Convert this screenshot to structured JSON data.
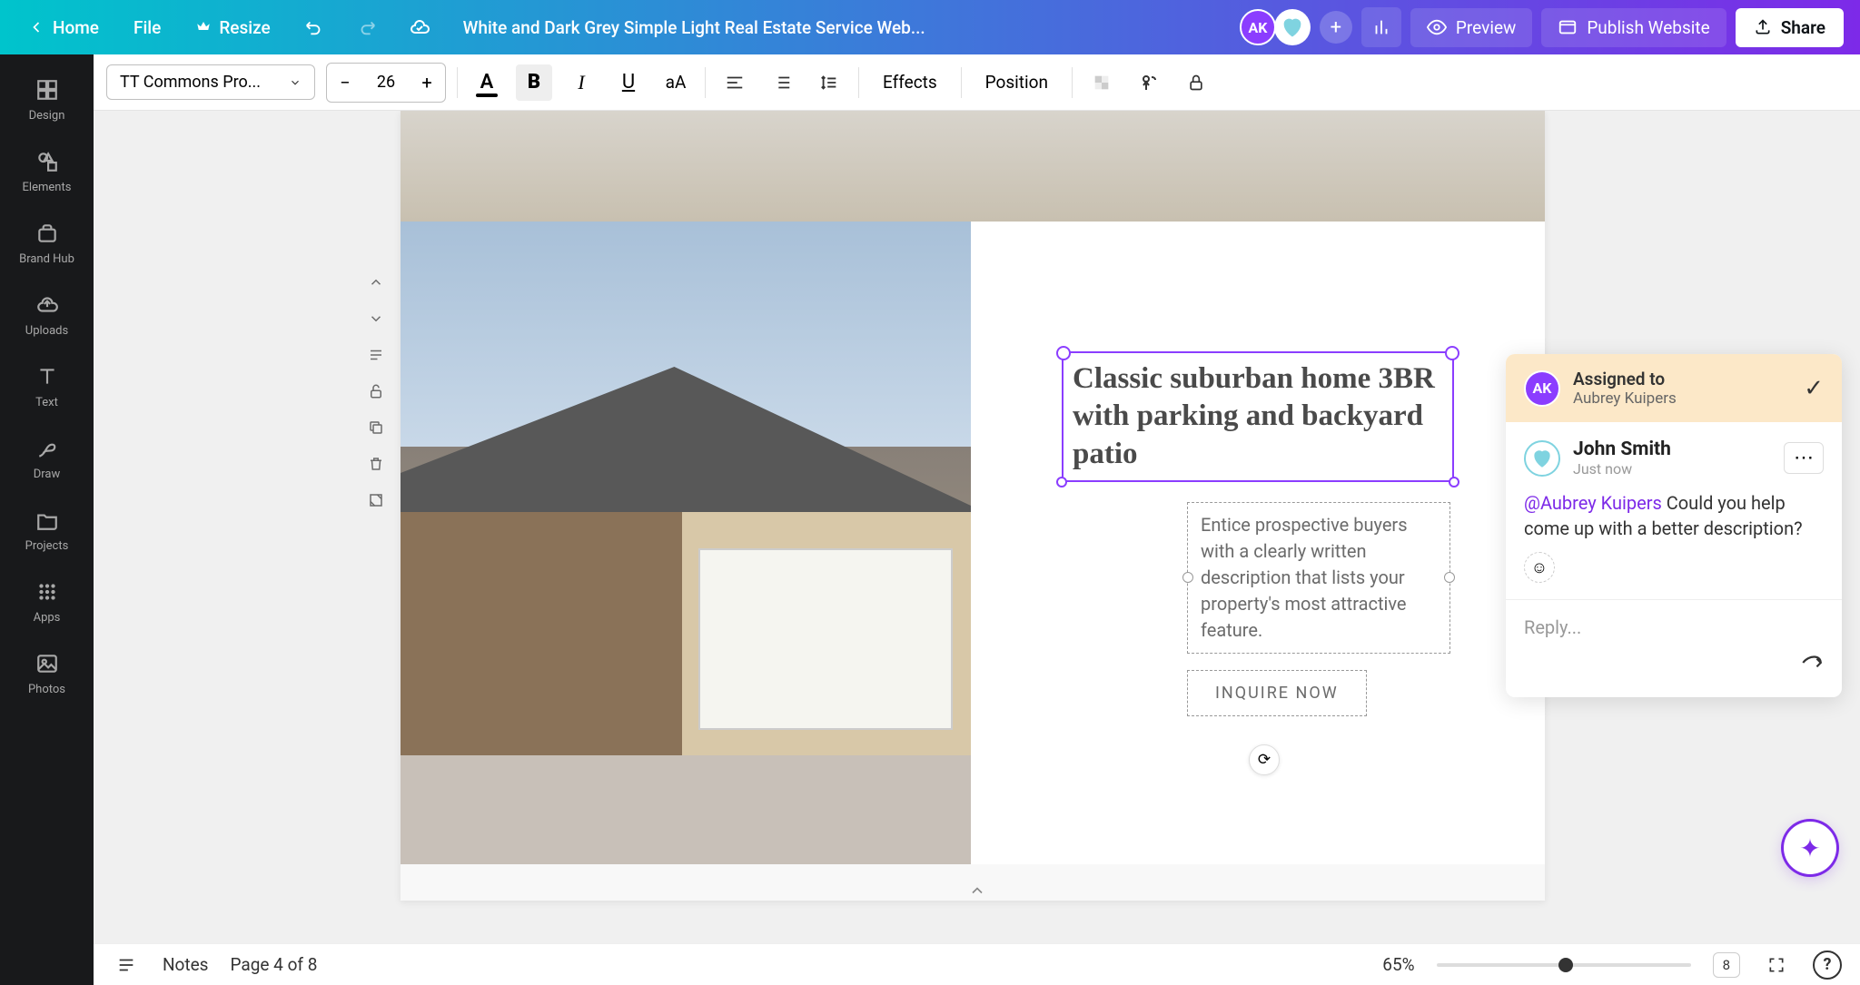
{
  "topbar": {
    "home": "Home",
    "file": "File",
    "resize": "Resize",
    "docTitle": "White and Dark Grey Simple Light Real Estate Service Web...",
    "avatarInitials": "AK",
    "preview": "Preview",
    "publish": "Publish Website",
    "share": "Share"
  },
  "toolbar": {
    "font": "TT Commons Pro...",
    "fontSize": "26",
    "effects": "Effects",
    "position": "Position"
  },
  "sidebar": {
    "items": [
      {
        "label": "Design"
      },
      {
        "label": "Elements"
      },
      {
        "label": "Brand Hub"
      },
      {
        "label": "Uploads"
      },
      {
        "label": "Text"
      },
      {
        "label": "Draw"
      },
      {
        "label": "Projects"
      },
      {
        "label": "Apps"
      },
      {
        "label": "Photos"
      }
    ]
  },
  "canvas": {
    "heading": "Classic suburban home 3BR with parking and backyard patio",
    "description": "Entice prospective buyers with a clearly written description that lists your property's most attractive feature.",
    "inquire": "INQUIRE NOW"
  },
  "comment": {
    "assignedLabel": "Assigned to",
    "assignedName": "Aubrey Kuipers",
    "assignedInitials": "AK",
    "authorName": "John Smith",
    "time": "Just now",
    "mention": "@Aubrey Kuipers",
    "body": " Could you help come up with a better description?",
    "replyPlaceholder": "Reply..."
  },
  "bottombar": {
    "notes": "Notes",
    "pageLabel": "Page 4 of 8",
    "zoom": "65%",
    "pageCount": "8"
  }
}
